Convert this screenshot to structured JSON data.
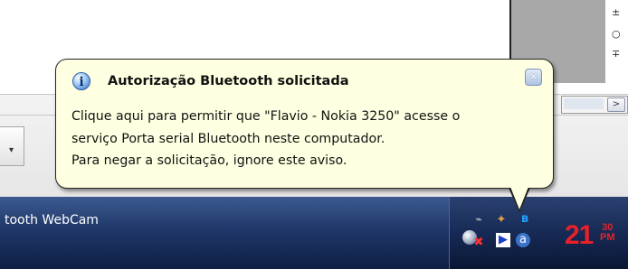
{
  "balloon": {
    "title": "Autorização Bluetooth solicitada",
    "lines": [
      "Clique aqui para permitir que \"Flavio - Nokia 3250\" acesse o",
      "serviço Porta serial Bluetooth neste computador.",
      "Para negar a solicitação, ignore este aviso."
    ],
    "close_icon": "close-icon",
    "info_icon": "info-icon"
  },
  "taskbar": {
    "button_label": "tooth WebCam"
  },
  "clock": {
    "hour": "21",
    "minute": "30",
    "ampm": "PM"
  },
  "colors": {
    "balloon_bg": "#ffffe1",
    "taskbar": "#1f3769",
    "clock": "#e8202a"
  }
}
